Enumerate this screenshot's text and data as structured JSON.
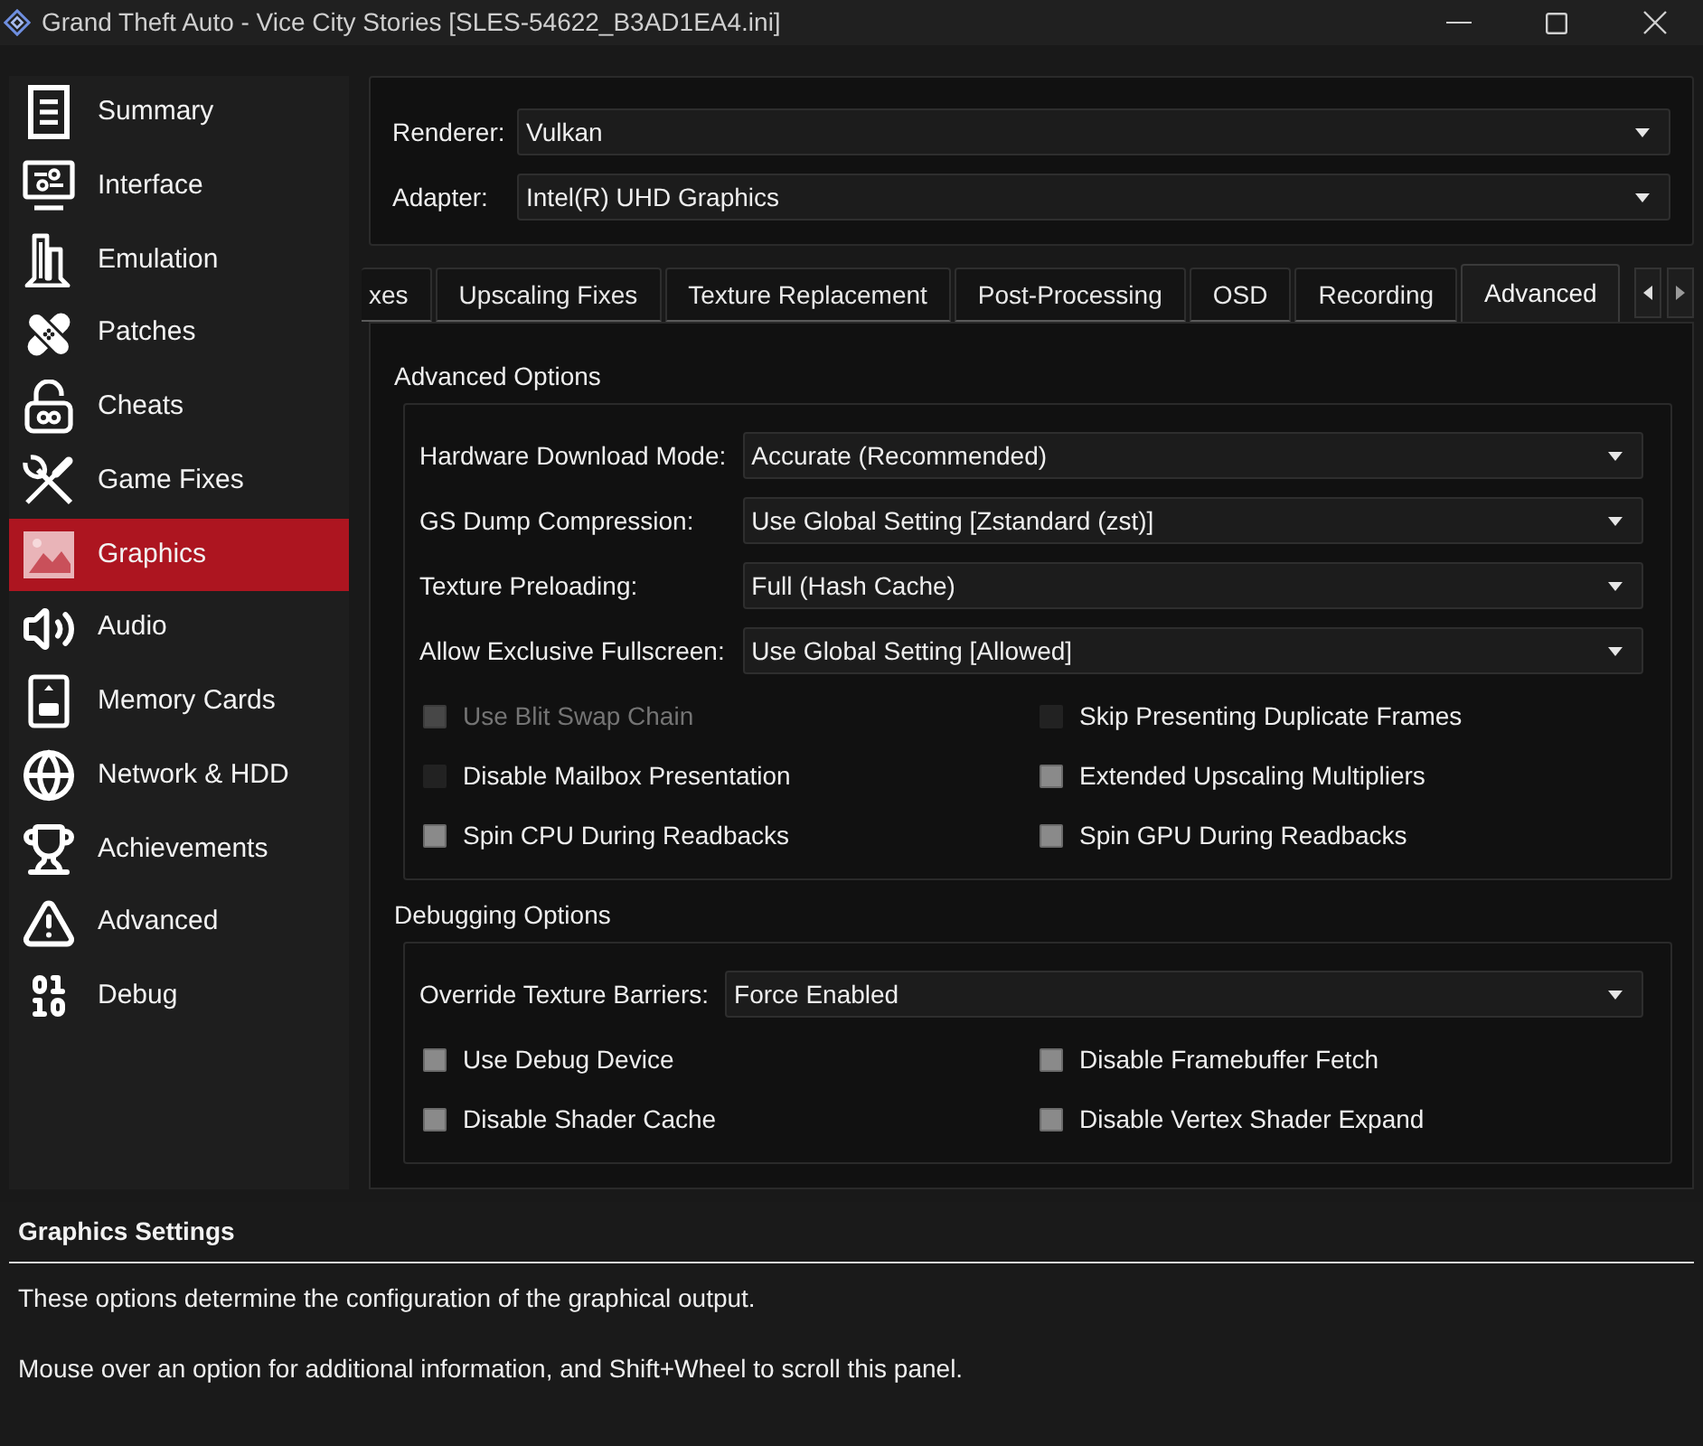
{
  "window": {
    "title": "Grand Theft Auto - Vice City Stories [SLES-54622_B3AD1EA4.ini]"
  },
  "sidebar": {
    "items": [
      {
        "label": "Summary",
        "selected": false
      },
      {
        "label": "Interface",
        "selected": false
      },
      {
        "label": "Emulation",
        "selected": false
      },
      {
        "label": "Patches",
        "selected": false
      },
      {
        "label": "Cheats",
        "selected": false
      },
      {
        "label": "Game Fixes",
        "selected": false
      },
      {
        "label": "Graphics",
        "selected": true
      },
      {
        "label": "Audio",
        "selected": false
      },
      {
        "label": "Memory Cards",
        "selected": false
      },
      {
        "label": "Network & HDD",
        "selected": false
      },
      {
        "label": "Achievements",
        "selected": false
      },
      {
        "label": "Advanced",
        "selected": false
      },
      {
        "label": "Debug",
        "selected": false
      }
    ]
  },
  "device": [
    {
      "label": "Renderer:",
      "value": "Vulkan"
    },
    {
      "label": "Adapter:",
      "value": "Intel(R) UHD Graphics"
    }
  ],
  "tabs": [
    {
      "label": "xes",
      "selected": false
    },
    {
      "label": "Upscaling Fixes",
      "selected": false
    },
    {
      "label": "Texture Replacement",
      "selected": false
    },
    {
      "label": "Post-Processing",
      "selected": false
    },
    {
      "label": "OSD",
      "selected": false
    },
    {
      "label": "Recording",
      "selected": false
    },
    {
      "label": "Advanced",
      "selected": true
    }
  ],
  "groups": [
    {
      "title": "Advanced Options",
      "dropdowns": [
        {
          "label": "Hardware Download Mode:",
          "value": "Accurate (Recommended)"
        },
        {
          "label": "GS Dump Compression:",
          "value": "Use Global Setting [Zstandard (zst)]"
        },
        {
          "label": "Texture Preloading:",
          "value": "Full (Hash Cache)"
        },
        {
          "label": "Allow Exclusive Fullscreen:",
          "value": "Use Global Setting [Allowed]"
        }
      ],
      "checkboxes": [
        {
          "label": "Use Blit Swap Chain",
          "partially_checked": true,
          "disabled": true
        },
        {
          "label": "Skip Presenting Duplicate Frames",
          "partially_checked": false,
          "disabled": false
        },
        {
          "label": "Disable Mailbox Presentation",
          "partially_checked": false,
          "disabled": false
        },
        {
          "label": "Extended Upscaling Multipliers",
          "partially_checked": true,
          "disabled": false
        },
        {
          "label": "Spin CPU During Readbacks",
          "partially_checked": true,
          "disabled": false
        },
        {
          "label": "Spin GPU During Readbacks",
          "partially_checked": true,
          "disabled": false
        }
      ]
    },
    {
      "title": "Debugging Options",
      "dropdowns": [
        {
          "label": "Override Texture Barriers:",
          "value": "Force Enabled"
        }
      ],
      "checkboxes": [
        {
          "label": "Use Debug Device",
          "partially_checked": true,
          "disabled": false
        },
        {
          "label": "Disable Framebuffer Fetch",
          "partially_checked": true,
          "disabled": false
        },
        {
          "label": "Disable Shader Cache",
          "partially_checked": true,
          "disabled": false
        },
        {
          "label": "Disable Vertex Shader Expand",
          "partially_checked": true,
          "disabled": false
        }
      ]
    }
  ],
  "help": {
    "title": "Graphics Settings",
    "paragraphs": [
      "These options determine the configuration of the graphical output.",
      "Mouse over an option for additional information, and Shift+Wheel to scroll this panel."
    ]
  }
}
